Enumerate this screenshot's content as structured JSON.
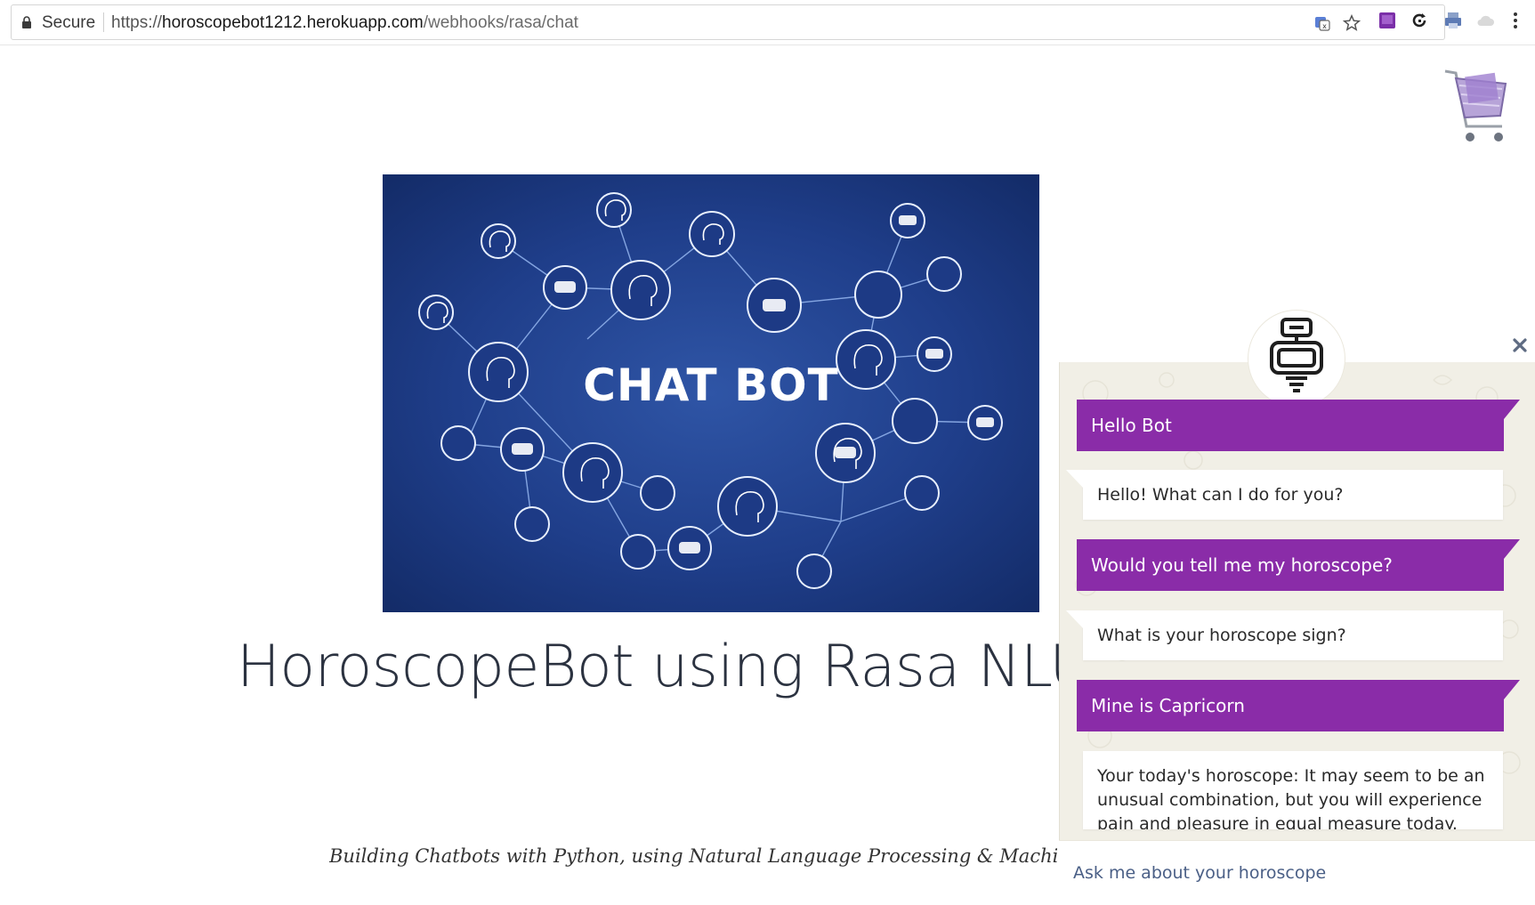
{
  "browser": {
    "secure_label": "Secure",
    "url_protocol": "https://",
    "url_host": "horoscopebot1212.herokuapp.com",
    "url_path": "/webhooks/rasa/chat"
  },
  "icons": {
    "lock": "lock-icon",
    "translate": "translate-icon",
    "bookmark": "star-icon",
    "ext1": "book-extension-icon",
    "ext2": "reload-extension-icon",
    "ext3": "printer-extension-icon",
    "ext4": "cloud-extension-icon",
    "menu": "kebab-menu-icon",
    "close": "close-icon",
    "bot": "robot-icon",
    "cart": "shopping-cart-icon"
  },
  "hero": {
    "title": "CHAT BOT"
  },
  "page": {
    "title": "HoroscopeBot using Rasa NLU",
    "subtitle": "Building Chatbots with Python, using Natural Language Processing & Machine Learning by Sum"
  },
  "chat": {
    "messages": [
      {
        "from": "user",
        "text": "Hello Bot"
      },
      {
        "from": "bot",
        "text": "Hello! What can I do for you?"
      },
      {
        "from": "user",
        "text": "Would you tell me my horoscope?"
      },
      {
        "from": "bot",
        "text": "What is your horoscope sign?"
      },
      {
        "from": "user",
        "text": "Mine is Capricorn"
      },
      {
        "from": "bot",
        "text": "Your today's horoscope: It may seem to be an unusual combination, but you will experience pain and pleasure in equal measure today."
      }
    ],
    "input_placeholder": "Ask me about your horoscope"
  },
  "colors": {
    "user_bubble": "#8a2ca8",
    "bot_bubble": "#ffffff",
    "chat_background": "#f1efe6",
    "hero_blue": "#1f3e8a",
    "title_text": "#2b3240"
  }
}
